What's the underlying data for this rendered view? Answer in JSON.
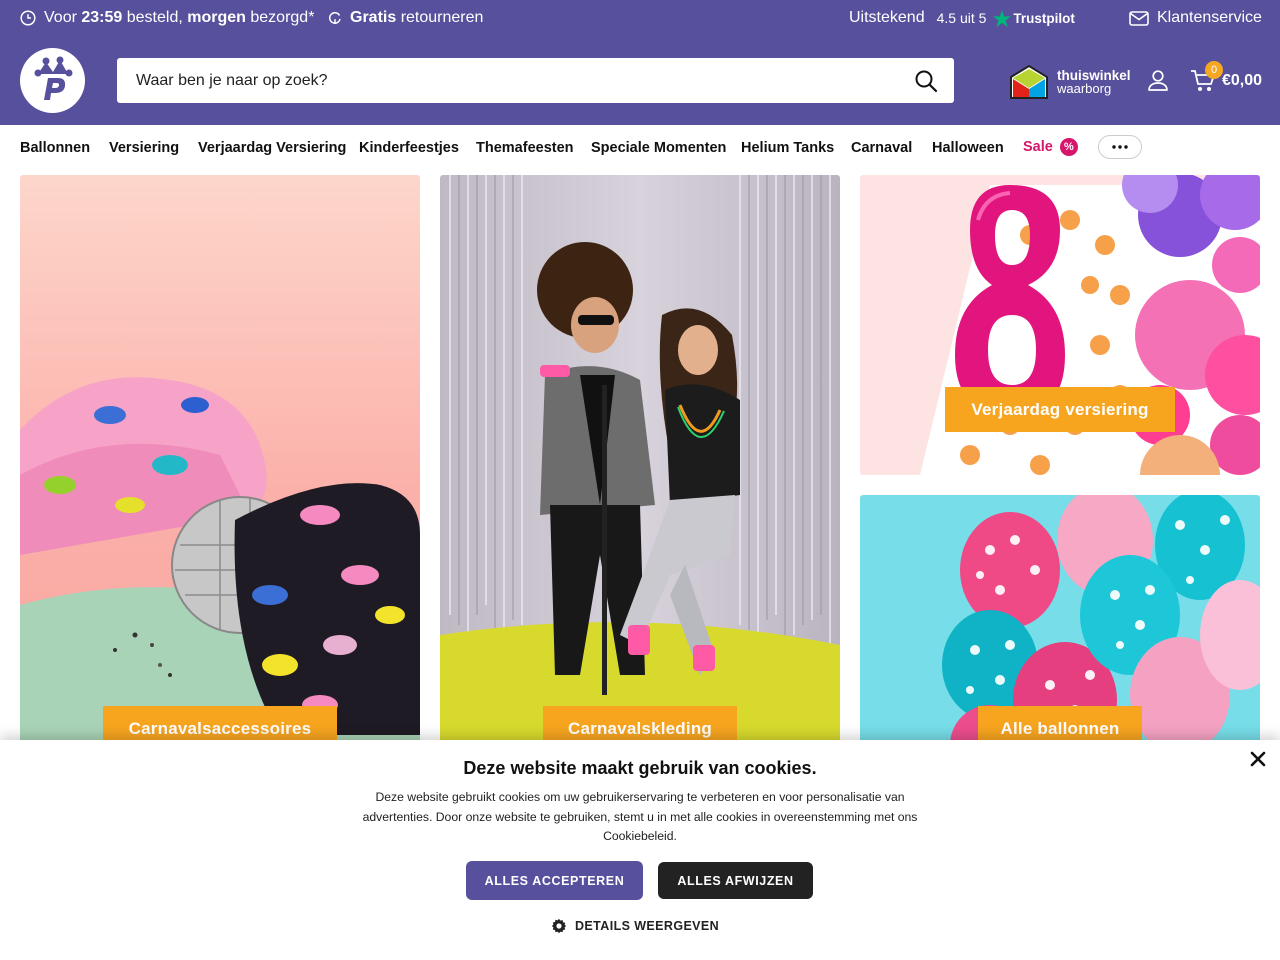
{
  "topbar": {
    "delivery": {
      "pre": "Voor",
      "time": "23:59",
      "mid": "besteld,",
      "day": "morgen",
      "post": "bezorgd*"
    },
    "returns": {
      "bold": "Gratis",
      "rest": "retourneren"
    },
    "rating": {
      "label": "Uitstekend",
      "score": "4.5 uit 5",
      "brand": "Trustpilot"
    },
    "service": "Klantenservice"
  },
  "header": {
    "search_placeholder": "Waar ben je naar op zoek?",
    "trust_line1": "thuiswinkel",
    "trust_line2": "waarborg",
    "cart_count": "0",
    "cart_total": "€0,00"
  },
  "nav": {
    "items": [
      "Ballonnen",
      "Versiering",
      "Verjaardag Versiering",
      "Kinderfeestjes",
      "Themafeesten",
      "Speciale Momenten",
      "Helium Tanks",
      "Carnaval",
      "Halloween"
    ],
    "sale": "Sale",
    "sale_badge": "%"
  },
  "tiles": [
    {
      "label": "Carnavalsaccessoires"
    },
    {
      "label": "Carnavalskleding"
    },
    {
      "label": "Verjaardag versiering"
    },
    {
      "label": "Alle ballonnen"
    }
  ],
  "cookie": {
    "title": "Deze website maakt gebruik van cookies.",
    "body": "Deze website gebruikt cookies om uw gebruikerservaring te verbeteren en voor personalisatie van advertenties. Door onze website te gebruiken, stemt u in met alle cookies in overeenstemming met ons Cookiebeleid.",
    "accept": "ALLES ACCEPTEREN",
    "reject": "ALLES AFWIJZEN",
    "details": "DETAILS WEERGEVEN"
  },
  "colors": {
    "brand": "#57509c",
    "accent": "#f7a51f",
    "sale": "#d6166b",
    "trustpilot": "#00b67a"
  }
}
